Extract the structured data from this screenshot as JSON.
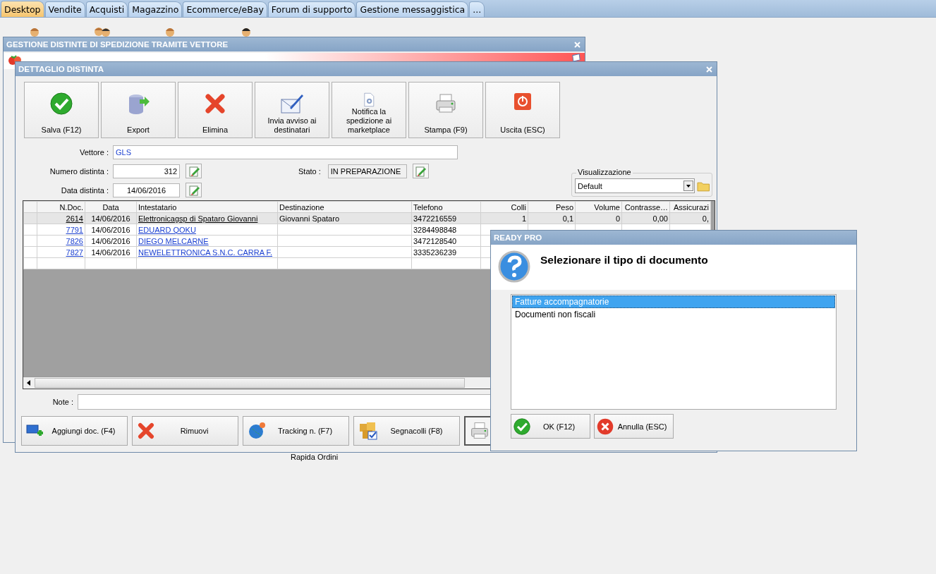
{
  "tabs": [
    {
      "label": "Desktop",
      "selected": true
    },
    {
      "label": "Vendite",
      "selected": false
    },
    {
      "label": "Acquisti",
      "selected": false
    },
    {
      "label": "Magazzino",
      "selected": false
    },
    {
      "label": "Ecommerce/eBay",
      "selected": false
    },
    {
      "label": "Forum di supporto",
      "selected": false
    },
    {
      "label": "Gestione messaggistica",
      "selected": false
    },
    {
      "label": "...",
      "selected": false
    }
  ],
  "desktop": {
    "icon_label": "Rapida Ordini"
  },
  "back_window": {
    "title": "GESTIONE DISTINTE DI SPEDIZIONE TRAMITE VETTORE"
  },
  "detail_window": {
    "title": "DETTAGLIO DISTINTA",
    "toolbar": [
      {
        "label": "Salva (F12)"
      },
      {
        "label": "Export"
      },
      {
        "label": "Elimina"
      },
      {
        "label": "Invia avviso ai destinatari"
      },
      {
        "label": "Notifica la spedizione ai marketplace"
      },
      {
        "label": "Stampa (F9)"
      },
      {
        "label": "Uscita (ESC)"
      }
    ],
    "vettore": {
      "label": "Vettore :",
      "value": "GLS"
    },
    "numero": {
      "label": "Numero distinta :",
      "value": "312"
    },
    "data": {
      "label": "Data distinta :",
      "value": "14/06/2016"
    },
    "stato": {
      "label": "Stato :",
      "value": "IN PREPARAZIONE"
    },
    "view": {
      "label": "Visualizzazione",
      "value": "Default"
    },
    "table": {
      "columns": [
        "N.Doc.",
        "Data",
        "Intestatario",
        "Destinazione",
        "Telefono",
        "Colli",
        "Peso",
        "Volume",
        "Contrasse…",
        "Assicurazi"
      ],
      "rows": [
        {
          "selected": true,
          "cells": [
            "2614",
            "14/06/2016",
            "Elettronicagsp di Spataro Giovanni",
            "Giovanni Spataro",
            "3472216559",
            "1",
            "0,1",
            "0",
            "0,00",
            "0,"
          ]
        },
        {
          "selected": false,
          "cells": [
            "7791",
            "14/06/2016",
            "EDUARD QOKU",
            "",
            "3284498848"
          ]
        },
        {
          "selected": false,
          "cells": [
            "7826",
            "14/06/2016",
            "DIEGO MELCARNE",
            "",
            "3472128540"
          ]
        },
        {
          "selected": false,
          "cells": [
            "7827",
            "14/06/2016",
            "NEWELETTRONICA S.N.C. CARRA F.",
            "",
            "3335236239"
          ]
        }
      ]
    },
    "note_label": "Note :",
    "bottom_buttons": [
      {
        "label": "Aggiungi doc. (F4)"
      },
      {
        "label": "Rimuovi"
      },
      {
        "label": "Tracking n. (F7)"
      },
      {
        "label": "Segnacolli (F8)"
      }
    ]
  },
  "dialog": {
    "title": "READY PRO",
    "heading": "Selezionare il tipo di documento",
    "options": [
      {
        "label": "Fatture accompagnatorie",
        "selected": true
      },
      {
        "label": "Documenti non fiscali",
        "selected": false
      }
    ],
    "buttons": [
      {
        "label": "OK (F12)"
      },
      {
        "label": "Annulla (ESC)"
      }
    ]
  }
}
